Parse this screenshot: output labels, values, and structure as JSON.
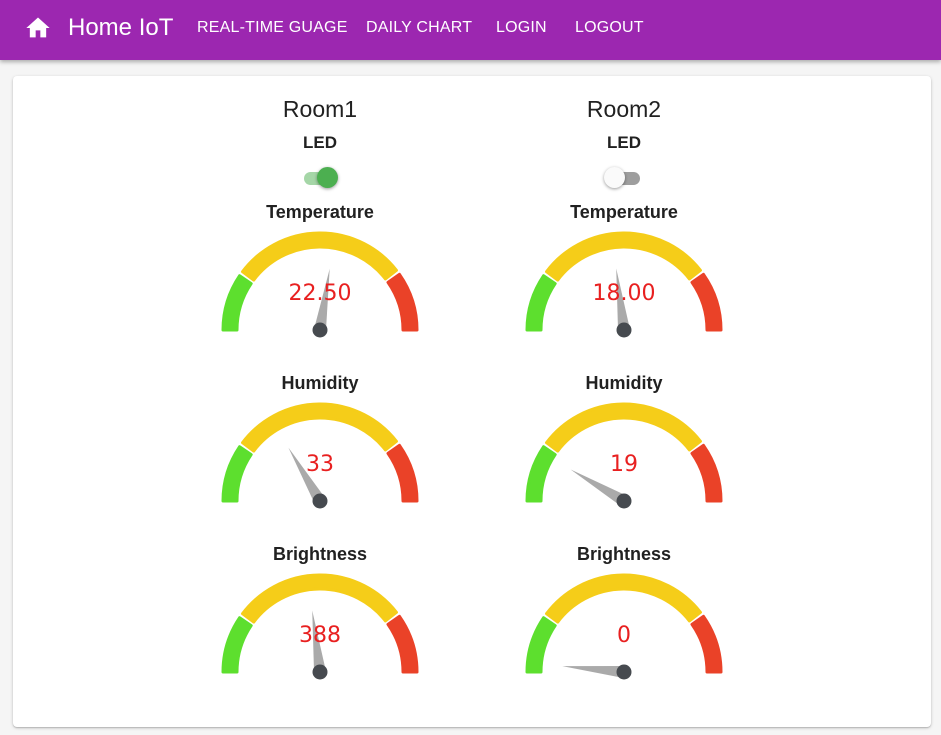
{
  "appbar": {
    "title": "Home IoT",
    "icon": "home-icon",
    "nav": [
      "REAL-TIME GUAGE",
      "DAILY CHART",
      "LOGIN",
      "LOGOUT"
    ],
    "color": "#9c27b0"
  },
  "rooms": [
    {
      "title": "Room1",
      "led_label": "LED",
      "led_on": true,
      "gauges": [
        {
          "label": "Temperature",
          "value_text": "22.50",
          "needle_fraction": 0.55
        },
        {
          "label": "Humidity",
          "value_text": "33",
          "needle_fraction": 0.33
        },
        {
          "label": "Brightness",
          "value_text": "388",
          "needle_fraction": 0.46
        }
      ]
    },
    {
      "title": "Room2",
      "led_label": "LED",
      "led_on": false,
      "gauges": [
        {
          "label": "Temperature",
          "value_text": "18.00",
          "needle_fraction": 0.46
        },
        {
          "label": "Humidity",
          "value_text": "19",
          "needle_fraction": 0.17
        },
        {
          "label": "Brightness",
          "value_text": "0",
          "needle_fraction": 0.03
        }
      ]
    }
  ],
  "gauge_colors": {
    "low": "#5ddf2e",
    "mid": "#f5cd19",
    "high": "#ea4228",
    "needle": "#aaaaaa",
    "hub": "#464a4f",
    "value_text": "#e82020"
  }
}
